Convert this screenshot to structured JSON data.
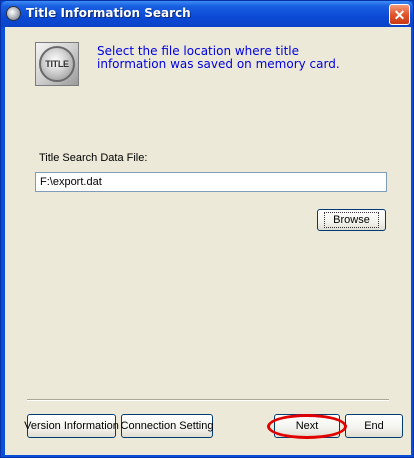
{
  "window": {
    "title": "Title Information Search",
    "close_glyph": "✕"
  },
  "logo": {
    "text": "TITLE",
    "icon": "title-logo-icon"
  },
  "instruction": {
    "line1": "Select the file location where title",
    "line2": "information was saved on memory card."
  },
  "file_field": {
    "label": "Title Search Data File:",
    "value": "F:\\export.dat"
  },
  "buttons": {
    "browse": "Browse",
    "version_information": "Version Information",
    "connection_setting": "Connection Setting",
    "next": "Next",
    "end": "End"
  },
  "colors": {
    "titlebar": "#0a4fd8",
    "instruction_text": "#0000e0",
    "highlight": "#e00000",
    "dialog_background": "#ece9d8"
  }
}
